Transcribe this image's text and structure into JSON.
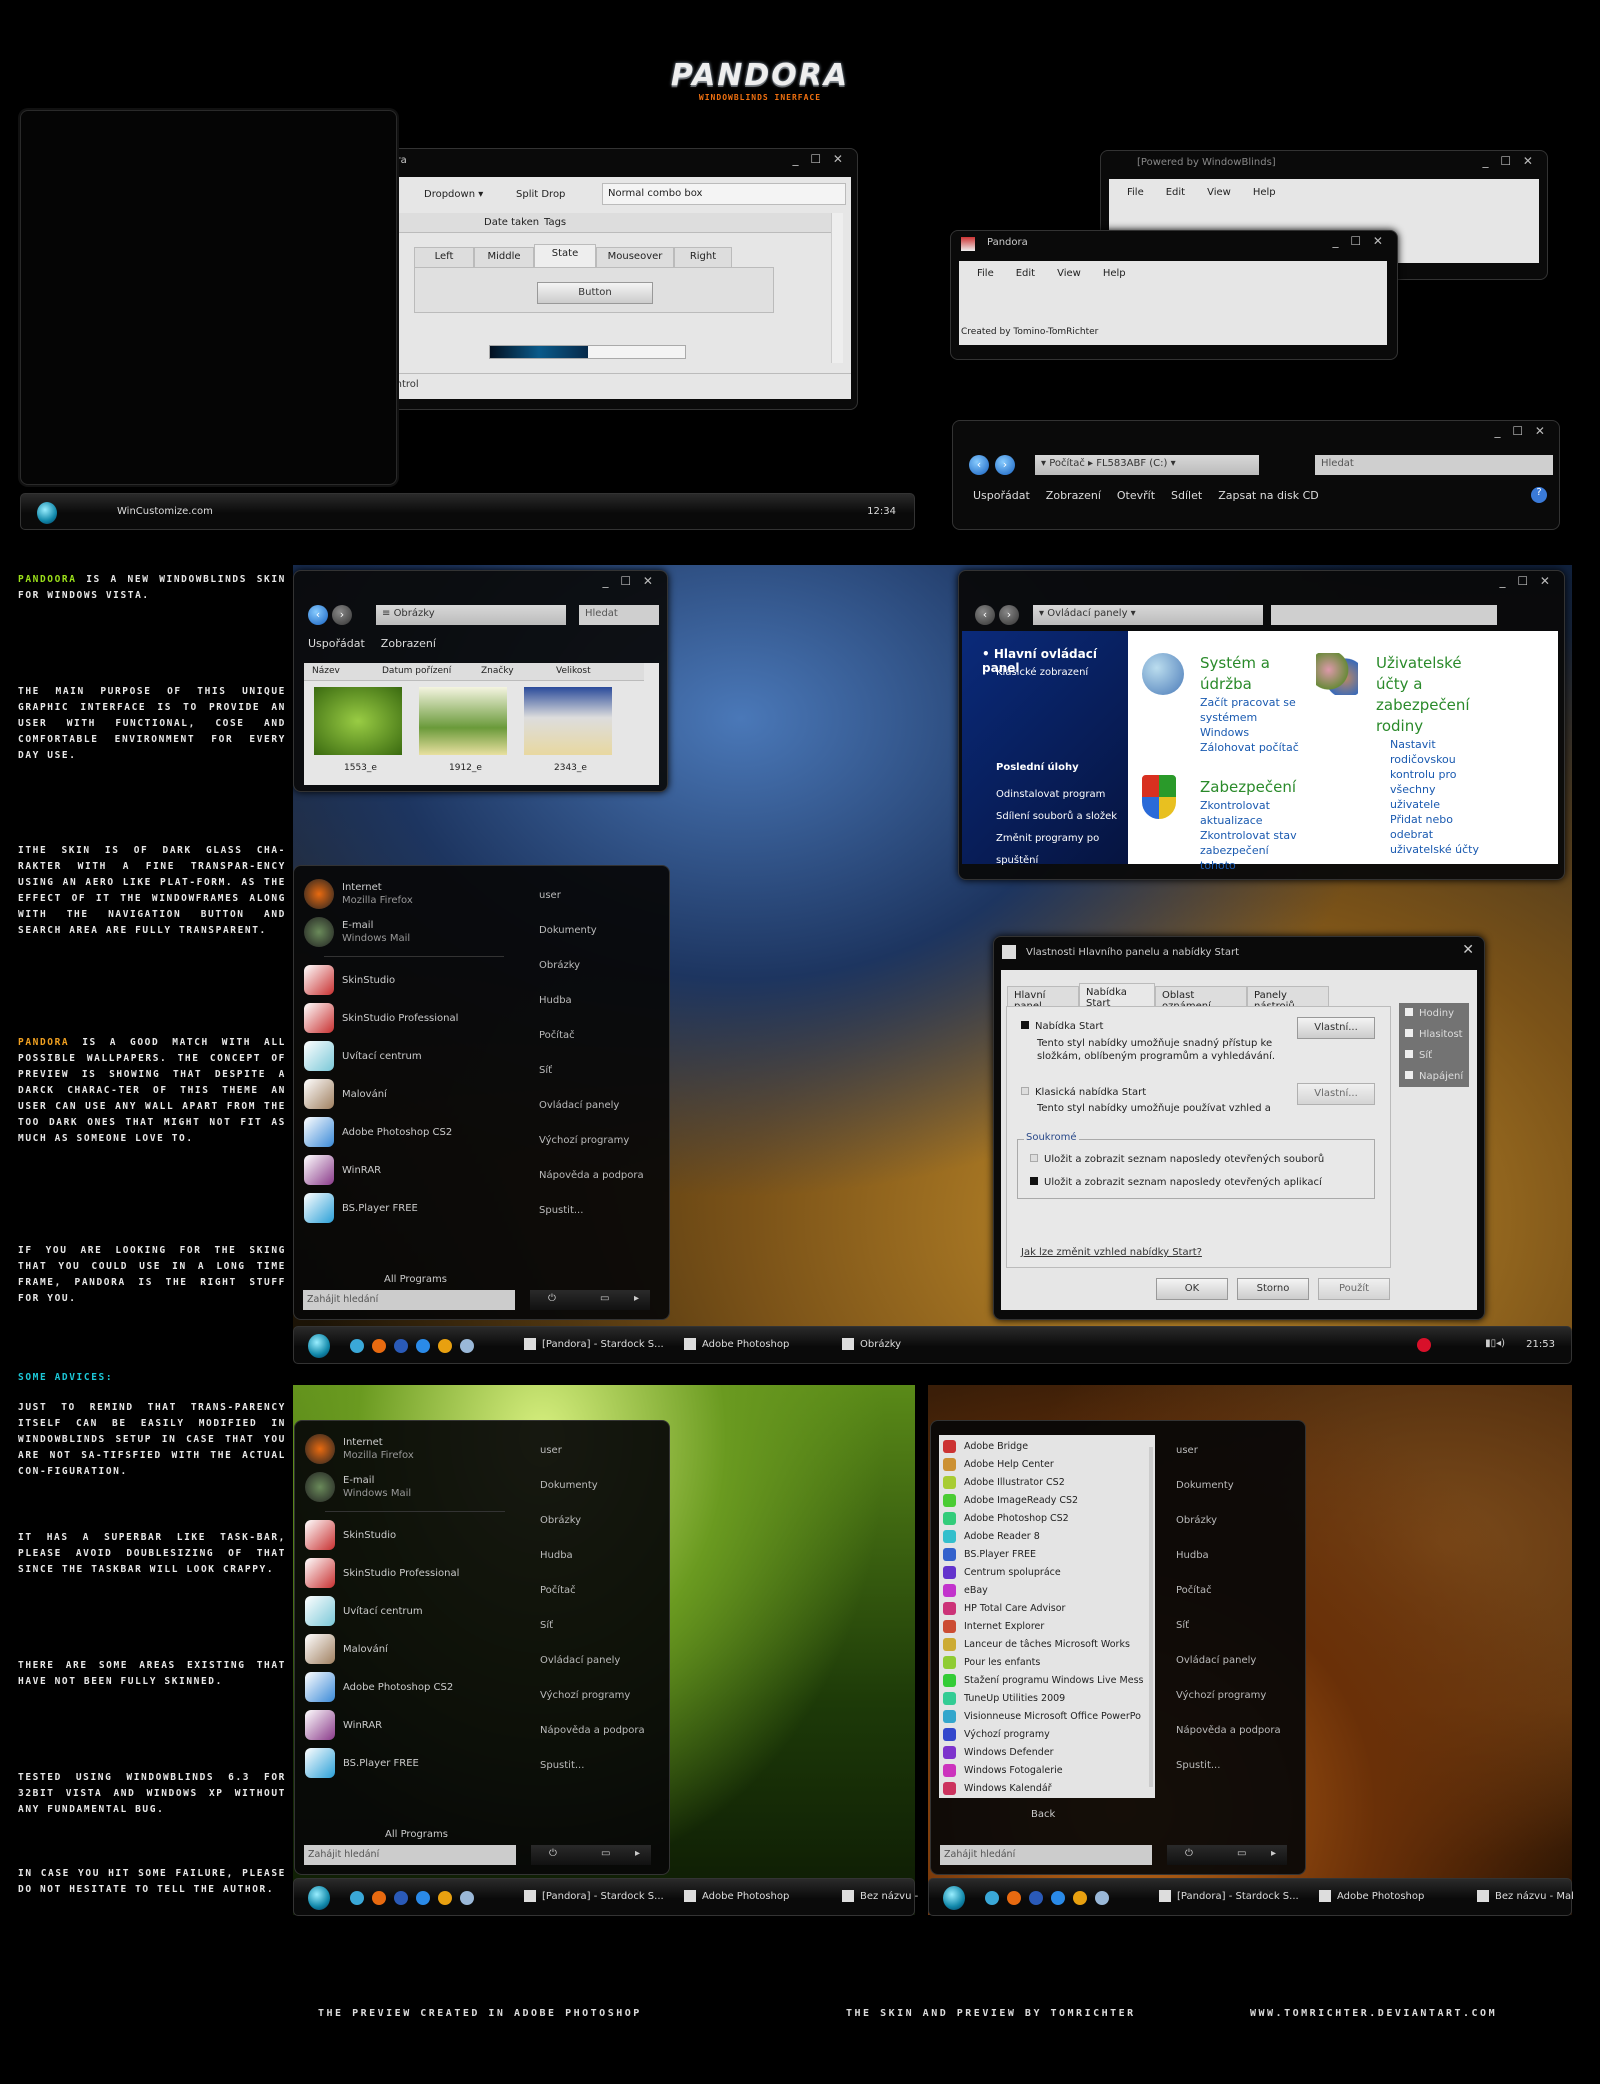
{
  "logo": {
    "title": "PANDORA",
    "subtitle": "WINDOWBLINDS INERFACE"
  },
  "demo_window": {
    "title": "Pandora",
    "toolbar": [
      "Dropdown",
      "Split Drop"
    ],
    "combo_value": "Normal combo box",
    "columns": [
      "Date taken",
      "Tags"
    ],
    "tabs": [
      "Left",
      "Middle",
      "State",
      "Mouseover",
      "Right"
    ],
    "active_tab": "State",
    "button_label": "Button",
    "progress_percent": 50,
    "status": "control"
  },
  "taskbar_top": {
    "label": "WinCustomize.com",
    "clock": "12:34"
  },
  "powered_window": {
    "title": "[Powered by WindowBlinds]",
    "menu": [
      "File",
      "Edit",
      "View",
      "Help"
    ]
  },
  "pandora_window": {
    "title": "Pandora",
    "menu": [
      "File",
      "Edit",
      "View",
      "Help"
    ],
    "status": "Created by Tomino-TomRichter"
  },
  "explorer_toolbar": {
    "breadcrumb": [
      "Počítač",
      "FL583ABF (C:)"
    ],
    "search_placeholder": "Hledat",
    "commands": [
      "Uspořádat",
      "Zobrazení",
      "Otevřít",
      "Sdílet",
      "Zapsat na disk CD"
    ]
  },
  "description": {
    "p1_highlight": "PANDOORA",
    "p1": " IS A NEW WINDOWBLINDS SKIN FOR WINDOWS VISTA.",
    "p2": "THE MAIN PURPOSE OF THIS UNIQUE GRAPHIC INTERFACE IS TO PROVIDE AN USER WITH FUNCTIONAL, COSE AND COMFORTABLE ENVIRONMENT FOR EVERY DAY USE.",
    "p3": "ITHE SKIN IS OF DARK GLASS CHA-RAKTER WITH A FINE TRANSPAR-ENCY USING AN AERO LIKE PLAT-FORM. AS THE EFFECT OF IT THE WINDOWFRAMES ALONG WITH THE NAVIGATION BUTTON AND SEARCH AREA ARE FULLY TRANSPARENT.",
    "p4_highlight": "PANDORA",
    "p4": " IS A GOOD MATCH WITH ALL POSSIBLE WALLPAPERS. THE CONCEPT OF PREVIEW IS SHOWING THAT DESPITE A DARCK CHARAC-TER OF THIS THEME AN USER CAN USE ANY WALL APART FROM THE TOO DARK ONES THAT MIGHT NOT FIT AS MUCH AS SOMEONE LOVE TO.",
    "p5": "IF YOU ARE LOOKING FOR THE SKING THAT YOU COULD USE IN A LONG TIME FRAME, PANDORA IS THE RIGHT STUFF FOR YOU.",
    "advices_title": "SOME ADVICES:",
    "a1": "JUST TO REMIND THAT TRANS-PARENCY ITSELF CAN BE EASILY MODIFIED IN WINDOWBLINDS SETUP IN CASE THAT YOU ARE NOT SA-TIFSFIED WITH THE ACTUAL CON-FIGURATION.",
    "a2": "IT HAS A SUPERBAR LIKE TASK-BAR, PLEASE AVOID DOUBLESIZING OF THAT SINCE THE TASKBAR WILL LOOK CRAPPY.",
    "a3": "THERE ARE SOME AREAS EXISTING THAT HAVE NOT BEEN FULLY SKINNED.",
    "a4": "TESTED USING WINDOWBLINDS 6.3 FOR 32BIT VISTA AND WINDOWS XP WITHOUT ANY FUNDAMENTAL BUG.",
    "a5": "IN CASE YOU HIT SOME FAILURE, PLEASE DO NOT HESITATE TO TELL THE AUTHOR."
  },
  "pictures_window": {
    "address": "Obrázky",
    "search_placeholder": "Hledat",
    "commands": [
      "Uspořádat",
      "Zobrazení"
    ],
    "columns": [
      "Název",
      "Datum pořízení",
      "Značky",
      "Velikost"
    ],
    "files": [
      "1553_e",
      "1912_e",
      "2343_e"
    ]
  },
  "control_panel": {
    "address": "Ovládací panely",
    "side_title": "Hlavní ovládací panel",
    "side_classic": "Klasické zobrazení",
    "recent_title": "Poslední úlohy",
    "recent": [
      "Odinstalovat program",
      "Sdílení souborů a složek",
      "Změnit programy po spuštění"
    ],
    "cat1": {
      "title": "Systém a údržba",
      "links": [
        "Začít pracovat se systémem Windows",
        "Zálohovat počítač"
      ]
    },
    "cat2": {
      "title": "Uživatelské účty a zabezpečení rodiny",
      "links": [
        "Nastavit rodičovskou kontrolu pro všechny uživatele",
        "Přidat nebo odebrat uživatelské účty"
      ]
    },
    "cat3": {
      "title": "Zabezpečení",
      "links": [
        "Zkontrolovat aktualizace",
        "Zkontrolovat stav zabezpečení tohoto"
      ]
    }
  },
  "start_menu": {
    "pinned": [
      {
        "name": "Internet",
        "sub": "Mozilla Firefox",
        "icon": "firefox-icon",
        "color": "#e86a10"
      },
      {
        "name": "E-mail",
        "sub": "Windows Mail",
        "icon": "mail-icon",
        "color": "#6a8a5a"
      }
    ],
    "programs": [
      {
        "name": "SkinStudio",
        "icon": "skinstudio-icon",
        "color": "#c83030"
      },
      {
        "name": "SkinStudio Professional",
        "icon": "skinstudio-icon",
        "color": "#c83030"
      },
      {
        "name": "Uvítací centrum",
        "icon": "welcome-center-icon",
        "color": "#7ac8d8"
      },
      {
        "name": "Malování",
        "icon": "paint-icon",
        "color": "#a08060"
      },
      {
        "name": "Adobe Photoshop CS2",
        "icon": "photoshop-icon",
        "color": "#3a8ad8"
      },
      {
        "name": "WinRAR",
        "icon": "winrar-icon",
        "color": "#8a3a8a"
      },
      {
        "name": "BS.Player FREE",
        "icon": "bsplayer-icon",
        "color": "#2aa0d8"
      }
    ],
    "right": [
      "user",
      "Dokumenty",
      "Obrázky",
      "Hudba",
      "Počítač",
      "Síť",
      "Ovládací panely",
      "Výchozí programy",
      "Nápověda a podpora",
      "Spustit..."
    ],
    "all_programs": "All Programs",
    "back": "Back",
    "search_placeholder": "Zahájit hledání",
    "all_list": [
      "Adobe Bridge",
      "Adobe Help Center",
      "Adobe Illustrator CS2",
      "Adobe ImageReady CS2",
      "Adobe Photoshop CS2",
      "Adobe Reader 8",
      "BS.Player FREE",
      "Centrum spolupráce",
      "eBay",
      "HP Total Care Advisor",
      "Internet Explorer",
      "Lanceur de tâches Microsoft Works",
      "Pour les enfants",
      "Stažení programu Windows Live Mess",
      "TuneUp Utilities 2009",
      "Visionneuse Microsoft Office PowerPo",
      "Výchozí programy",
      "Windows Defender",
      "Windows Fotogalerie",
      "Windows Kalendář"
    ]
  },
  "properties_dialog": {
    "title": "Vlastnosti Hlavního panelu a nabídky Start",
    "tabs": [
      "Hlavní panel",
      "Nabídka Start",
      "Oblast oznámení",
      "Panely nástrojů"
    ],
    "active_tab": "Nabídka Start",
    "opt1": "Nabídka Start",
    "opt1_desc": "Tento styl nabídky umožňuje snadný přístup ke složkám, oblíbeným programům a vyhledávání.",
    "opt2": "Klasická nabídka Start",
    "opt2_desc": "Tento styl nabídky umožňuje používat vzhled a",
    "customize": "Vlastní...",
    "privacy_title": "Soukromé",
    "privacy1": "Uložit a zobrazit seznam naposledy otevřených souborů",
    "privacy2": "Uložit a zobrazit seznam naposledy otevřených aplikací",
    "help_link": "Jak lze změnit vzhled nabídky Start?",
    "ok": "OK",
    "cancel": "Storno",
    "apply": "Použít",
    "tray": [
      "Hodiny",
      "Hlasitost",
      "Síť",
      "Napájení"
    ]
  },
  "taskbar_main": {
    "tasks": [
      "[Pandora] - Stardock S...",
      "Adobe Photoshop",
      "Obrázky"
    ],
    "clock": "21:53"
  },
  "taskbar_green": {
    "tasks": [
      "[Pandora] - Stardock S...",
      "Adobe Photoshop",
      "Bez názvu -"
    ]
  },
  "taskbar_autumn": {
    "tasks": [
      "[Pandora] - Stardock S...",
      "Adobe Photoshop",
      "Bez názvu - Mal"
    ]
  },
  "footer": {
    "left": "THE PREVIEW CREATED IN ADOBE PHOTOSHOP",
    "middle": "THE SKIN AND PREVIEW BY TOMRICHTER",
    "right": "WWW.TOMRICHTER.DEVIANTART.COM"
  }
}
